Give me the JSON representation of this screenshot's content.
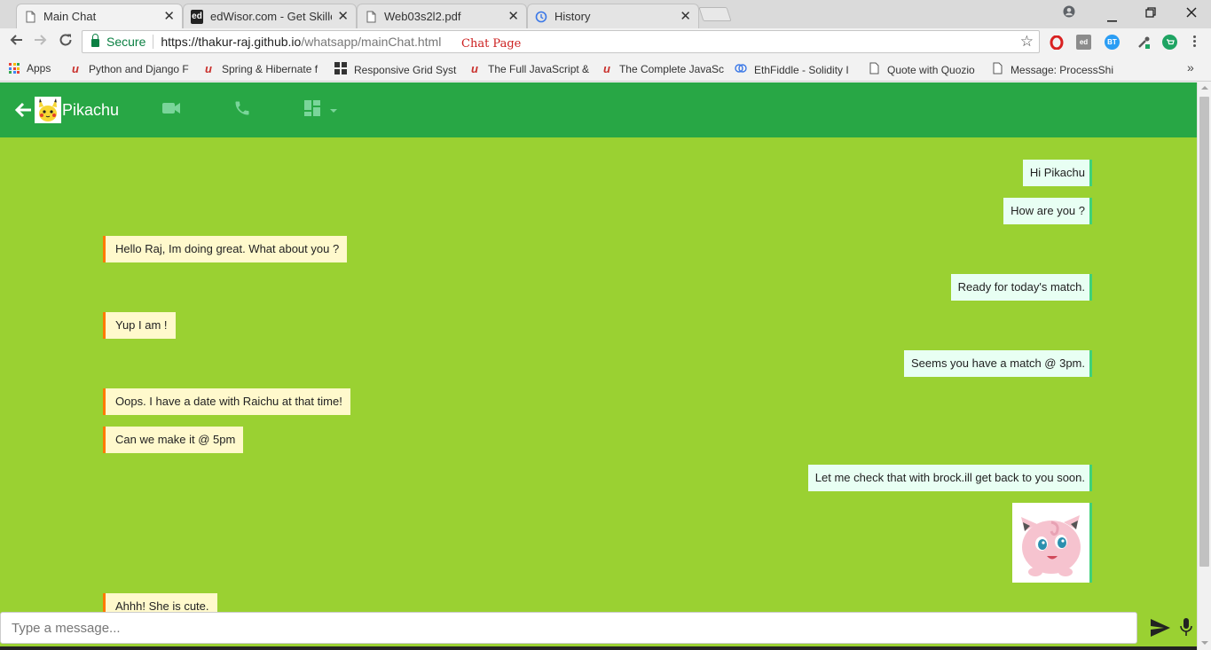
{
  "browser": {
    "tabs": [
      {
        "title": "Main Chat",
        "close": "✕"
      },
      {
        "title": "edWisor.com - Get Skilled",
        "close": "✕",
        "favicon_text": "ed"
      },
      {
        "title": "Web03s2l2.pdf",
        "close": "✕"
      },
      {
        "title": "History",
        "close": "✕"
      }
    ],
    "secure_label": "Secure",
    "url_host": "https://thakur-raj.github.io",
    "url_path": "/whatsapp/mainChat.html",
    "annotation": "Chat Page",
    "extensions": [
      {
        "name": "opera-icon",
        "color": "#d92121",
        "text": "O"
      },
      {
        "name": "edwisor-ext-icon",
        "color": "#8c8c8c",
        "text": "ed"
      },
      {
        "name": "bt-ext-icon",
        "color": "#2a9df4",
        "text": "BT"
      },
      {
        "name": "eyedropper-ext-icon",
        "color": "#5a5a5a",
        "text": ""
      },
      {
        "name": "cart-ext-icon",
        "color": "#1fa463",
        "text": ""
      }
    ],
    "bookmarks": [
      {
        "label": "Apps",
        "icon": "apps-grid-icon"
      },
      {
        "label": "Python and Django F",
        "icon": "udemy-icon"
      },
      {
        "label": "Spring & Hibernate f",
        "icon": "udemy-icon"
      },
      {
        "label": "Responsive Grid Syst",
        "icon": "grid-icon"
      },
      {
        "label": "The Full JavaScript &",
        "icon": "udemy-icon"
      },
      {
        "label": "The Complete JavaSc",
        "icon": "udemy-icon"
      },
      {
        "label": "EthFiddle - Solidity I",
        "icon": "ethfiddle-icon"
      },
      {
        "label": "Quote with Quozio",
        "icon": "page-icon"
      },
      {
        "label": "Message: ProcessShi",
        "icon": "page-icon"
      }
    ],
    "bookmarks_more": "»"
  },
  "chat": {
    "contact_name": "Pikachu",
    "messages": [
      {
        "side": "out",
        "text": "Hi Pikachu"
      },
      {
        "side": "out",
        "text": "How are you ?"
      },
      {
        "side": "in",
        "text": "Hello Raj, Im doing great. What about you ?"
      },
      {
        "side": "out",
        "text": "Ready for today's match."
      },
      {
        "side": "in",
        "text": "Yup I am !"
      },
      {
        "side": "out",
        "text": "Seems you have a match @ 3pm."
      },
      {
        "side": "in",
        "text": "Oops. I have a date with Raichu at that time!"
      },
      {
        "side": "in",
        "text": "Can we make it @ 5pm"
      },
      {
        "side": "out",
        "text": "Let me check that with brock.ill get back to you soon."
      },
      {
        "side": "out",
        "sticker": "jigglypuff-sticker"
      },
      {
        "side": "in",
        "text": "Ahhh! She is cute."
      }
    ],
    "composer_placeholder": "Type a message...",
    "colors": {
      "appbar": "#28a745",
      "background": "#9ad132",
      "incoming_bubble": "#fff9cc",
      "incoming_accent": "#ff7a00",
      "outgoing_bubble": "#e8fff3",
      "outgoing_accent": "#3fd17a"
    }
  }
}
